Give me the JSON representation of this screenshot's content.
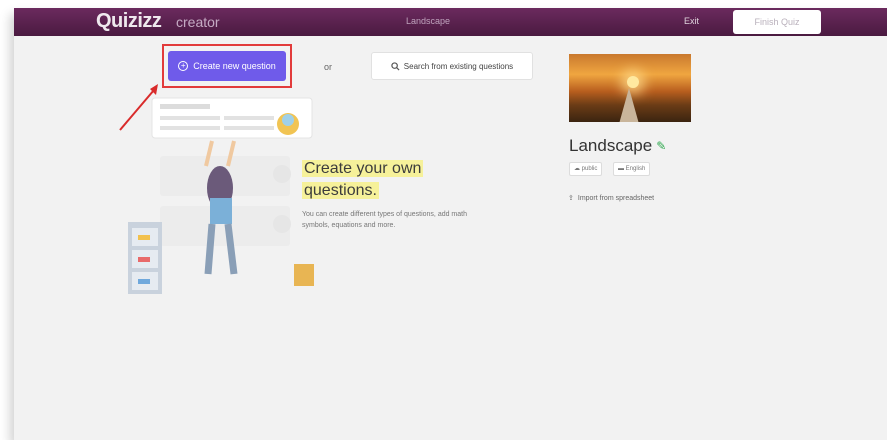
{
  "header": {
    "logo": "Quizizz",
    "logo_sub": "creator",
    "quiz_title": "Landscape",
    "exit_label": "Exit",
    "finish_label": "Finish Quiz"
  },
  "actions": {
    "create_label": "Create new question",
    "or_label": "or",
    "search_label": "Search from existing questions"
  },
  "promo": {
    "title_line1": "Create your own",
    "title_line2": "questions.",
    "description": "You can create different types of questions, add math symbols, equations and more."
  },
  "quiz": {
    "name": "Landscape",
    "visibility": "public",
    "language": "English",
    "import_label": "Import from spreadsheet"
  },
  "icons": [
    "plus-circle-icon",
    "search-icon",
    "pencil-icon",
    "globe-icon",
    "flag-icon",
    "upload-icon"
  ],
  "colors": {
    "topbar": "#5b2150",
    "primary_button": "#6f5bea",
    "highlight": "#f6f19a",
    "annotation": "#e23b3b",
    "edit_icon": "#2fa84f"
  }
}
